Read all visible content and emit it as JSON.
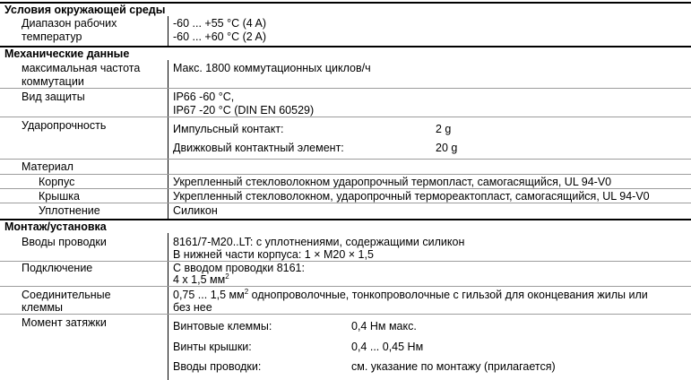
{
  "sections": {
    "env": "Условия окружающей среды",
    "mech": "Механические данные",
    "mount": "Монтаж/установка"
  },
  "env": {
    "temp_label_1": "Диапазон рабочих",
    "temp_label_2": "температур",
    "temp_value_1": "-60 ... +55 °C (4 A)",
    "temp_value_2": "-60 ... +60 °C (2 A)"
  },
  "mech": {
    "freq_label_1": "максимальная частота",
    "freq_label_2": "коммутации",
    "freq_value": "Макс. 1800 коммутационных циклов/ч",
    "protection_label": "Вид защиты",
    "protection_value_1": "IP66 -60 °C,",
    "protection_value_2": "IP67 -20 °C (DIN EN 60529)",
    "shock_label": "Ударопрочность",
    "shock_row1_name": "Импульсный контакт:",
    "shock_row1_value": "2 g",
    "shock_row2_name": "Движковый контактный элемент:",
    "shock_row2_value": "20 g",
    "material_label": "Материал",
    "body_label": "Корпус",
    "body_value": "Укрепленный стекловолокном ударопрочный термопласт, самогасящийся, UL 94-V0",
    "cover_label": "Крышка",
    "cover_value": "Укрепленный стекловолокном, ударопрочный термореактопласт, самогасящийся, UL 94-V0",
    "seal_label": "Уплотнение",
    "seal_value": "Силикон"
  },
  "mount": {
    "entries_label": "Вводы проводки",
    "entries_value_1": "8161/7-M20..LT: с уплотнениями, содержащими силикон",
    "entries_value_2": "В нижней части корпуса: 1 × M20 × 1,5",
    "connection_label": "Подключение",
    "connection_value_1": "С вводом проводки 8161:",
    "connection_value_2_main": "4 x 1,5 мм",
    "connection_value_2_sup": "2",
    "terminals_label_1": "Соединительные",
    "terminals_label_2": "клеммы",
    "terminals_value_1_pre": "0,75 ... 1,5 мм",
    "terminals_value_1_sup": "2",
    "terminals_value_1_post": " однопроволочные, тонкопроволочные с гильзой для оконцевания жилы или",
    "terminals_value_2": "без нее",
    "torque_label": "Момент затяжки",
    "torque_row1_name": "Винтовые клеммы:",
    "torque_row1_value": "0,4 Нм макс.",
    "torque_row2_name": "Винты крышки:",
    "torque_row2_value": "0,4 ... 0,45 Нм",
    "torque_row3_name": "Вводы проводки:",
    "torque_row3_value": "см. указание по монтажу (прилагается)"
  }
}
